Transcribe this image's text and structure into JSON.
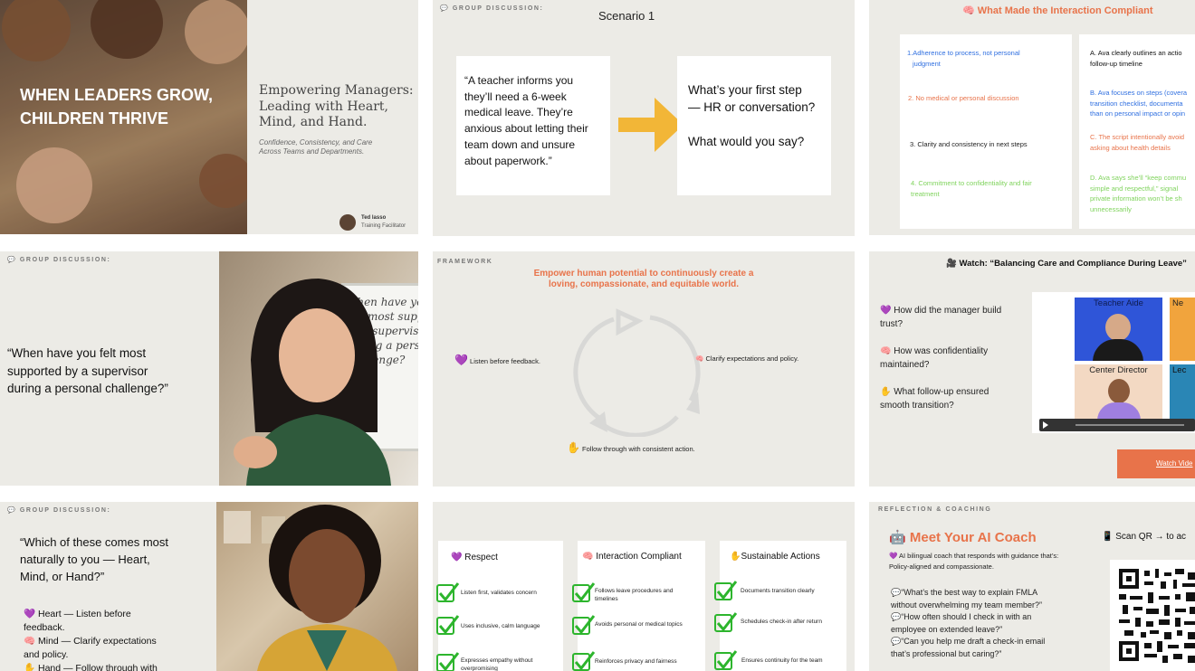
{
  "colors": {
    "slide_bg": "#ecebe6",
    "accent_orange": "#e8734a",
    "arrow_yellow": "#f2b637",
    "blue": "#2f6fe0",
    "red_orange": "#e8734a",
    "green": "#7fd35c",
    "check_green": "#2db52d"
  },
  "s1": {
    "title_line1": "WHEN LEADERS GROW,",
    "title_line2": "CHILDREN THRIVE",
    "heading_line1": "Empowering Managers:",
    "heading_line2": "Leading with Heart,",
    "heading_line3": "Mind, and Hand.",
    "sub_line1": "Confidence, Consistency, and Care",
    "sub_line2": "Across Teams and  Departments.",
    "presenter_name": "Ted lasso",
    "presenter_role": "Training Facilitator"
  },
  "s2": {
    "tag": "GROUP DISCUSSION:",
    "title": "Scenario 1",
    "quote_lines": [
      "“A teacher informs you",
      "they’ll need a 6-week",
      "medical leave. They’re",
      "anxious about letting their",
      "team down and unsure",
      "about paperwork.”"
    ],
    "q_lines": [
      "What’s your first step",
      "— HR or conversation?"
    ],
    "q2": "What would you say?"
  },
  "s3": {
    "title": "What Made the Interaction Compliant",
    "left": [
      {
        "lines": [
          "1.Adherence to process, not personal",
          "judgment"
        ]
      },
      {
        "lines": [
          "2. No medical or personal discussion"
        ]
      },
      {
        "lines": [
          "3. Clarity and consistency in next steps"
        ]
      },
      {
        "lines": [
          "4. Commitment to confidentiality and fair",
          "treatment"
        ]
      }
    ],
    "right": [
      {
        "lines": [
          "A. Ava clearly outlines an actio",
          "follow-up timeline"
        ]
      },
      {
        "lines": [
          "B. Ava focuses on steps (covera",
          "transition checklist, documenta",
          "than on personal impact or opin"
        ]
      },
      {
        "lines": [
          "C. The script intentionally avoid",
          "asking about health details"
        ]
      },
      {
        "lines": [
          "D. Ava says she’ll “keep commu",
          "simple and respectful,” signal",
          "private information won’t be sh",
          "unnecessarily"
        ]
      }
    ]
  },
  "s4": {
    "tag": "GROUP DISCUSSION:",
    "quote_lines": [
      "“When have you felt most",
      "supported by a supervisor",
      "during a personal challenge?”"
    ],
    "board_lines": [
      "When have yo",
      "felt most suppo",
      "by a supervisor",
      "during a perso",
      "challenge?"
    ]
  },
  "s5": {
    "tag": "FRAMEWORK",
    "title_line1": "Empower human potential to continuously create a",
    "title_line2": "loving, compassionate, and equitable world.",
    "item_left": "Listen before feedback.",
    "item_right": "Clarify expectations and policy.",
    "item_bottom": "Follow through with consistent action."
  },
  "s6": {
    "title": "Watch: “Balancing Care and Compliance During Leave”",
    "questions": [
      {
        "lines": [
          "How did the manager build",
          "trust?"
        ]
      },
      {
        "lines": [
          "How was confidentiality",
          "maintained?"
        ]
      },
      {
        "lines": [
          "What follow-up ensured",
          "smooth transition?"
        ]
      }
    ],
    "video_labels": [
      "Teacher Aide",
      "Ne",
      "Center Director",
      "Lec"
    ],
    "button": "Watch Vide"
  },
  "s7": {
    "tag": "GROUP DISCUSSION:",
    "quote_lines": [
      "“Which of these comes most",
      "naturally to you — Heart,",
      "Mind, or Hand?”"
    ],
    "items": [
      {
        "lines": [
          "Heart — Listen before",
          "feedback."
        ]
      },
      {
        "lines": [
          "Mind — Clarify expectations",
          "and policy."
        ]
      },
      {
        "lines": [
          "Hand — Follow through with"
        ]
      }
    ]
  },
  "s8": {
    "columns": [
      {
        "title": "Respect",
        "items": [
          [
            "Listen first, validates concern"
          ],
          [
            "Uses inclusive, calm language"
          ],
          [
            "Expresses empathy without",
            "overpromising"
          ]
        ]
      },
      {
        "title": "Interaction Compliant",
        "items": [
          [
            "Follows leave procedures and",
            "timelines"
          ],
          [
            "Avoids personal or medical topics"
          ],
          [
            "Reinforces privacy and fairness"
          ]
        ]
      },
      {
        "title": "Sustainable Actions",
        "items": [
          [
            "Documents transition clearly"
          ],
          [
            "Schedules check-in after return"
          ],
          [
            "Ensures continuity for the team"
          ]
        ]
      }
    ]
  },
  "s9": {
    "tag": "REFLECTION & COACHING",
    "title": "Meet Your AI Coach",
    "desc_line1": "AI bilingual coach that responds with guidance that’s:",
    "desc_line2": "Policy-aligned and compassionate.",
    "prompts": [
      {
        "lines": [
          "“What’s the best way to explain FMLA",
          "without overwhelming my team member?”"
        ]
      },
      {
        "lines": [
          "“How often should I check in with an",
          "employee on extended leave?”"
        ]
      },
      {
        "lines": [
          "“Can you help me draft a check-in email",
          "that’s professional but caring?”"
        ]
      }
    ],
    "qr_label": "Scan QR →  to ac"
  }
}
